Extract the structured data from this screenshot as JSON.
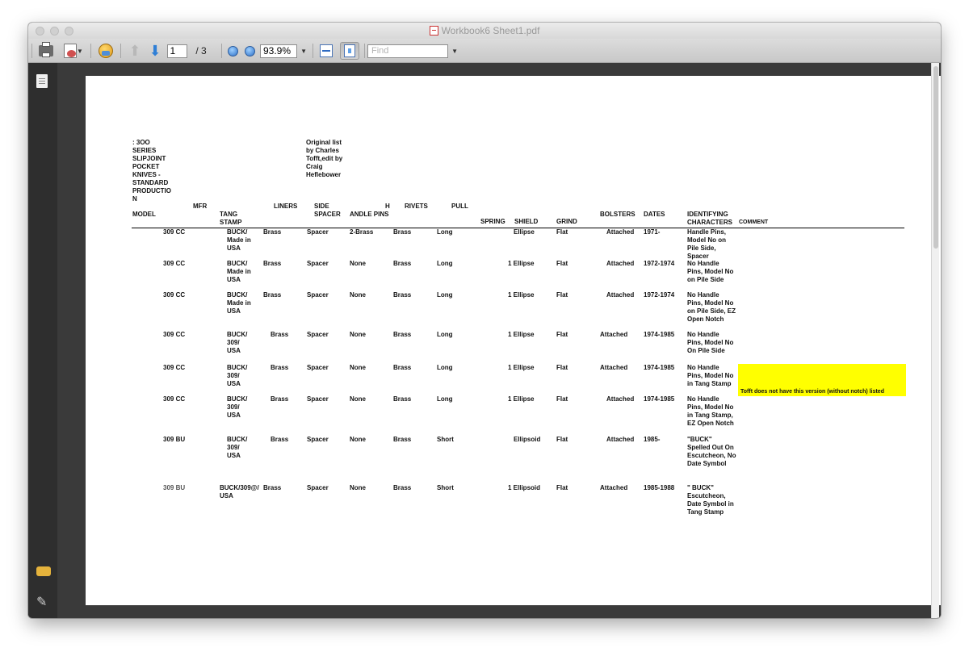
{
  "window": {
    "title": "Workbook6 Sheet1.pdf",
    "icon": "pdf-file-icon"
  },
  "toolbar": {
    "page_current": "1",
    "page_total": "/ 3",
    "zoom": "93.9%",
    "find_placeholder": "Find",
    "icons": [
      "print-icon",
      "export-icon",
      "globe-icon",
      "prev-page-icon",
      "next-page-icon",
      "zoom-out-icon",
      "zoom-in-icon",
      "fit-width-icon",
      "fit-page-icon"
    ]
  },
  "sidebar": {
    "icons": [
      "pages-icon",
      "comments-icon",
      "attachments-icon"
    ]
  },
  "document": {
    "header_left": ":      3OO\nSERIES\nSLIPJOINT\nPOCKET\nKNIVES -\nSTANDARD\nPRODUCTIO\nN",
    "header_credit": "Original list\nby Charles\nTofft,edit by\nCraig\nHeflebower",
    "columns": {
      "mfr": "MFR",
      "model": "MODEL",
      "tang_stamp": "TANG\nSTAMP",
      "liners": "LINERS",
      "side_spacer": "SIDE\nSPACER",
      "h": "H",
      "handle_pins": "ANDLE PINS",
      "rivets": "RIVETS",
      "pull": "PULL",
      "spring": "SPRING",
      "shield": "SHIELD",
      "grind": "GRIND",
      "bolsters": "BOLSTERS",
      "dates": "DATES",
      "identifying_characters": "IDENTIFYING\nCHARACTERS",
      "comment": "COMMENT"
    },
    "rows": [
      {
        "model": "309 CC",
        "tang": "BUCK/\nMade in\nUSA",
        "liners": "Brass",
        "spacer": "Spacer",
        "handle_pins": "2-Brass",
        "rivets": "Brass",
        "pull": "Long",
        "shield": "Ellipse",
        "grind": "Flat",
        "bolsters": "Attached",
        "dates": "1971-",
        "ident": "Handle Pins,\nModel No on\nPile Side,\nSpacer",
        "comment": ""
      },
      {
        "model": "309 CC",
        "tang": "BUCK/\nMade in\nUSA",
        "liners": "Brass",
        "spacer": "Spacer",
        "handle_pins": "None",
        "rivets": "Brass",
        "pull": "Long",
        "shield": "1 Ellipse",
        "grind": "Flat",
        "bolsters": "Attached",
        "dates": "1972-1974",
        "ident": "No Handle\nPins, Model No\non Pile Side",
        "comment": ""
      },
      {
        "model": "309 CC",
        "tang": "BUCK/\nMade in\nUSA",
        "liners": "Brass",
        "spacer": "Spacer",
        "handle_pins": "None",
        "rivets": "Brass",
        "pull": "Long",
        "shield": "1 Ellipse",
        "grind": "Flat",
        "bolsters": "Attached",
        "dates": "1972-1974",
        "ident": "No Handle\nPins, Model No\non Pile Side, EZ\nOpen Notch",
        "comment": ""
      },
      {
        "model": "309 CC",
        "tang": "BUCK/\n309/\nUSA",
        "liners": "Brass",
        "spacer": "Spacer",
        "handle_pins": "None",
        "rivets": "Brass",
        "pull": "Long",
        "shield": "1 Ellipse",
        "grind": "Flat",
        "bolsters": "Attached",
        "dates": "1974-1985",
        "ident": "No Handle\nPins, Model No\nOn Pile Side",
        "comment": ""
      },
      {
        "model": "309 CC",
        "tang": "BUCK/\n309/\nUSA",
        "liners": "Brass",
        "spacer": "Spacer",
        "handle_pins": "None",
        "rivets": "Brass",
        "pull": "Long",
        "shield": "1 Ellipse",
        "grind": "Flat",
        "bolsters": "Attached",
        "dates": "1974-1985",
        "ident": "No Handle\nPins, Model No\nin Tang Stamp",
        "comment": "Tofft does not have this version (without notch) listed"
      },
      {
        "model": "309 CC",
        "tang": "BUCK/\n309/\nUSA",
        "liners": "Brass",
        "spacer": "Spacer",
        "handle_pins": "None",
        "rivets": "Brass",
        "pull": "Long",
        "shield": "1 Ellipse",
        "grind": "Flat",
        "bolsters": "Attached",
        "dates": "1974-1985",
        "ident": "No Handle\nPins, Model No\nin Tang Stamp,\nEZ Open Notch",
        "comment": ""
      },
      {
        "model": "309 BU",
        "tang": "BUCK/\n309/\nUSA",
        "liners": "Brass",
        "spacer": "Spacer",
        "handle_pins": "None",
        "rivets": "Brass",
        "pull": "Short",
        "shield": "Ellipsoid",
        "grind": "Flat",
        "bolsters": "Attached",
        "dates": "1985-",
        "ident": "\"BUCK\"\nSpelled Out On\nEscutcheon, No\nDate Symbol",
        "comment": ""
      },
      {
        "model": "309 BU",
        "tang": "BUCK/309@/\nUSA",
        "liners": "Brass",
        "spacer": "Spacer",
        "handle_pins": "None",
        "rivets": "Brass",
        "pull": "Short",
        "shield": "1 Ellipsoid",
        "grind": "Flat",
        "bolsters": "Attached",
        "dates": "1985-1988",
        "ident": "\" BUCK\"\nEscutcheon,\nDate Symbol in\nTang Stamp",
        "comment": ""
      }
    ],
    "highlight_color": "#ffff00"
  }
}
